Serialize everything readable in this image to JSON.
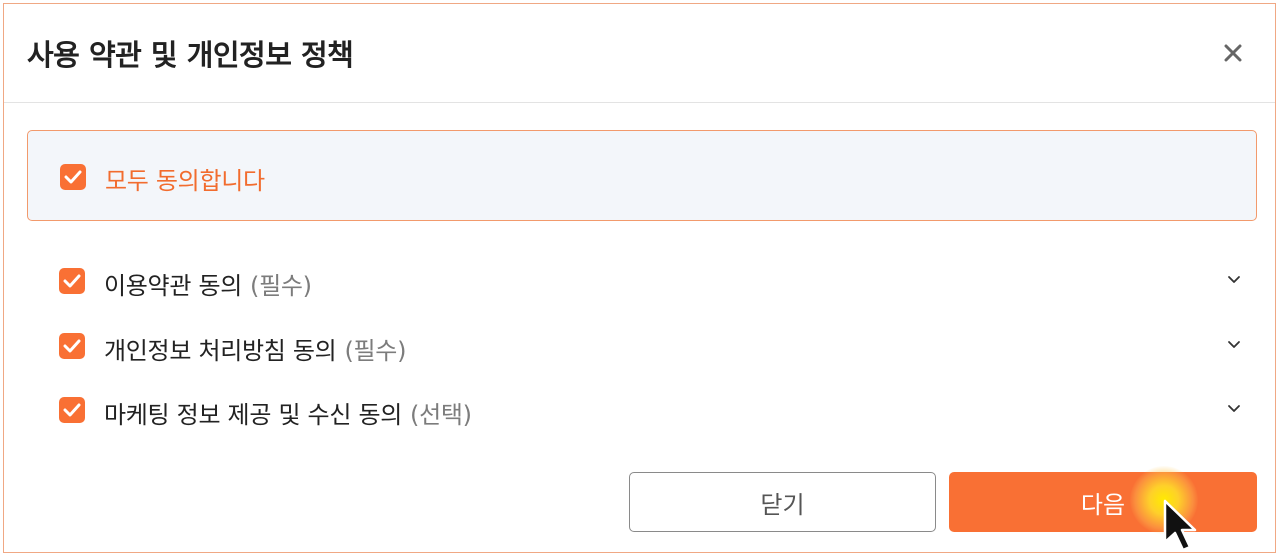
{
  "dialog": {
    "title": "사용 약관 및 개인정보 정책",
    "close_icon": "close-icon"
  },
  "all_agree": {
    "label": "모두 동의합니다",
    "checked": true
  },
  "terms": [
    {
      "label": "이용약관 동의",
      "tag": "(필수)",
      "checked": true
    },
    {
      "label": "개인정보 처리방침 동의",
      "tag": "(필수)",
      "checked": true
    },
    {
      "label": "마케팅 정보 제공 및 수신 동의",
      "tag": "(선택)",
      "checked": true
    }
  ],
  "buttons": {
    "close_label": "닫기",
    "next_label": "다음"
  },
  "colors": {
    "accent": "#f97034",
    "accent_text": "#f26c2e",
    "border": "#f0a884",
    "highlight_bg": "#f3f6fa"
  }
}
